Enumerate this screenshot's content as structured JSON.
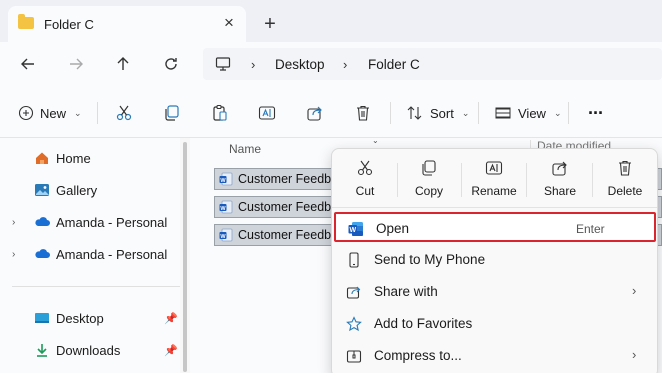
{
  "window": {
    "tab_title": "Folder C"
  },
  "address": {
    "crumbs": [
      "Desktop",
      "Folder C"
    ]
  },
  "toolbar": {
    "new_label": "New",
    "sort_label": "Sort",
    "view_label": "View",
    "more_label": "···"
  },
  "sidebar": {
    "items": [
      {
        "label": "Home",
        "icon": "home-icon"
      },
      {
        "label": "Gallery",
        "icon": "gallery-icon"
      },
      {
        "label": "Amanda - Personal",
        "icon": "cloud-icon"
      },
      {
        "label": "Amanda - Personal",
        "icon": "cloud-icon"
      },
      {
        "label": "Desktop",
        "icon": "desktop-icon"
      },
      {
        "label": "Downloads",
        "icon": "download-icon"
      }
    ]
  },
  "filelist": {
    "col_name": "Name",
    "col_date": "Date modified",
    "rows": [
      "Customer Feedback",
      "Customer Feedback",
      "Customer Feedback"
    ]
  },
  "context_menu": {
    "quick_actions": [
      {
        "label": "Cut",
        "icon": "scissors-icon"
      },
      {
        "label": "Copy",
        "icon": "copy-icon"
      },
      {
        "label": "Rename",
        "icon": "rename-icon"
      },
      {
        "label": "Share",
        "icon": "share-icon"
      },
      {
        "label": "Delete",
        "icon": "trash-icon"
      }
    ],
    "items": [
      {
        "label": "Open",
        "shortcut": "Enter",
        "icon": "word-icon"
      },
      {
        "label": "Send to My Phone",
        "icon": "phone-icon"
      },
      {
        "label": "Share with",
        "icon": "share-with-icon",
        "submenu": "›"
      },
      {
        "label": "Add to Favorites",
        "icon": "star-icon"
      },
      {
        "label": "Compress to...",
        "icon": "zip-icon",
        "submenu": "›"
      }
    ]
  },
  "colors": {
    "highlight_border": "#d9262e",
    "folder": "#f5c342",
    "word_blue": "#185abd"
  }
}
